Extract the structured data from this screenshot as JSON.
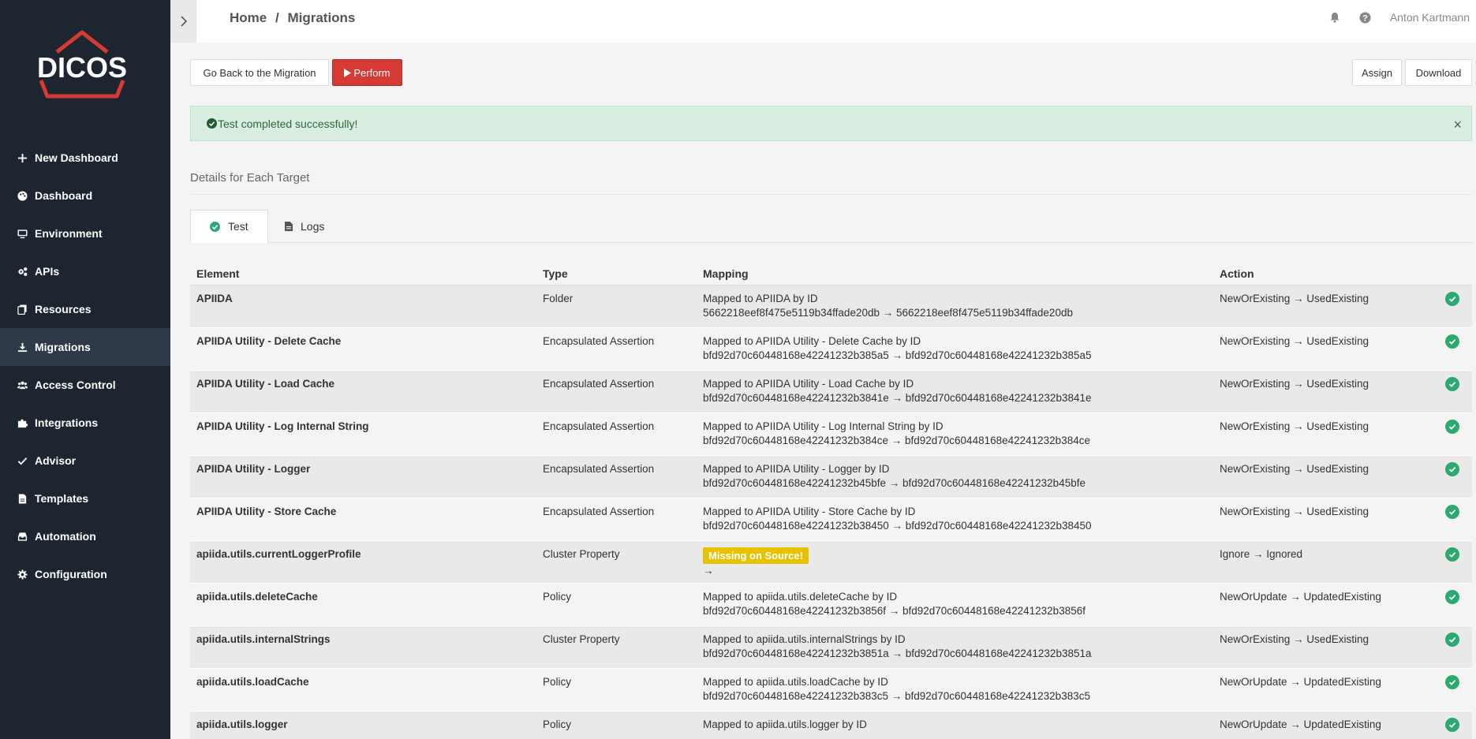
{
  "brand": {
    "name": "DICOS",
    "accent": "#d63a35"
  },
  "sidebar": {
    "items": [
      {
        "label": "New Dashboard",
        "icon": "plus-icon",
        "active": false
      },
      {
        "label": "Dashboard",
        "icon": "palette-icon",
        "active": false
      },
      {
        "label": "Environment",
        "icon": "monitor-icon",
        "active": false
      },
      {
        "label": "APIs",
        "icon": "cogs-icon",
        "active": false
      },
      {
        "label": "Resources",
        "icon": "copy-icon",
        "active": false
      },
      {
        "label": "Migrations",
        "icon": "download-icon",
        "active": true
      },
      {
        "label": "Access Control",
        "icon": "users-icon",
        "active": false
      },
      {
        "label": "Integrations",
        "icon": "puzzle-icon",
        "active": false
      },
      {
        "label": "Advisor",
        "icon": "check-icon",
        "active": false
      },
      {
        "label": "Templates",
        "icon": "file-icon",
        "active": false
      },
      {
        "label": "Automation",
        "icon": "inbox-icon",
        "active": false
      },
      {
        "label": "Configuration",
        "icon": "gear-icon",
        "active": false
      }
    ]
  },
  "header": {
    "breadcrumb": {
      "home": "Home",
      "sep": "/",
      "current": "Migrations"
    },
    "user": "Anton Kartmann"
  },
  "toolbar": {
    "back_label": "Go Back to the Migration",
    "perform_label": "Perform",
    "assign_label": "Assign",
    "download_label": "Download"
  },
  "alert": {
    "message": "Test completed successfully!",
    "close": "×"
  },
  "section": {
    "title": "Details for Each Target"
  },
  "tabs": [
    {
      "label": "Test",
      "icon": "check-circle-icon",
      "active": true
    },
    {
      "label": "Logs",
      "icon": "file-icon",
      "active": false
    }
  ],
  "table": {
    "headers": {
      "element": "Element",
      "type": "Type",
      "mapping": "Mapping",
      "action": "Action"
    },
    "rows": [
      {
        "element": "APIIDA",
        "type": "Folder",
        "mapping1": "Mapped to APIIDA by ID",
        "mapping2": "5662218eef8f475e5119b34ffade20db → 5662218eef8f475e5119b34ffade20db",
        "action": "NewOrExisting → UsedExisting",
        "badge": ""
      },
      {
        "element": "APIIDA Utility - Delete Cache",
        "type": "Encapsulated Assertion",
        "mapping1": "Mapped to APIIDA Utility - Delete Cache by ID",
        "mapping2": "bfd92d70c60448168e42241232b385a5 → bfd92d70c60448168e42241232b385a5",
        "action": "NewOrExisting → UsedExisting",
        "badge": ""
      },
      {
        "element": "APIIDA Utility - Load Cache",
        "type": "Encapsulated Assertion",
        "mapping1": "Mapped to APIIDA Utility - Load Cache by ID",
        "mapping2": "bfd92d70c60448168e42241232b3841e → bfd92d70c60448168e42241232b3841e",
        "action": "NewOrExisting → UsedExisting",
        "badge": ""
      },
      {
        "element": "APIIDA Utility - Log Internal String",
        "type": "Encapsulated Assertion",
        "mapping1": "Mapped to APIIDA Utility - Log Internal String by ID",
        "mapping2": "bfd92d70c60448168e42241232b384ce → bfd92d70c60448168e42241232b384ce",
        "action": "NewOrExisting → UsedExisting",
        "badge": ""
      },
      {
        "element": "APIIDA Utility - Logger",
        "type": "Encapsulated Assertion",
        "mapping1": "Mapped to APIIDA Utility - Logger by ID",
        "mapping2": "bfd92d70c60448168e42241232b45bfe → bfd92d70c60448168e42241232b45bfe",
        "action": "NewOrExisting → UsedExisting",
        "badge": ""
      },
      {
        "element": "APIIDA Utility - Store Cache",
        "type": "Encapsulated Assertion",
        "mapping1": "Mapped to APIIDA Utility - Store Cache by ID",
        "mapping2": "bfd92d70c60448168e42241232b38450 → bfd92d70c60448168e42241232b38450",
        "action": "NewOrExisting → UsedExisting",
        "badge": ""
      },
      {
        "element": "apiida.utils.currentLoggerProfile",
        "type": "Cluster Property",
        "mapping1": "",
        "mapping2": "→",
        "action": "Ignore → Ignored",
        "badge": "Missing on Source!"
      },
      {
        "element": "apiida.utils.deleteCache",
        "type": "Policy",
        "mapping1": "Mapped to apiida.utils.deleteCache by ID",
        "mapping2": "bfd92d70c60448168e42241232b3856f → bfd92d70c60448168e42241232b3856f",
        "action": "NewOrUpdate → UpdatedExisting",
        "badge": ""
      },
      {
        "element": "apiida.utils.internalStrings",
        "type": "Cluster Property",
        "mapping1": "Mapped to apiida.utils.internalStrings by ID",
        "mapping2": "bfd92d70c60448168e42241232b3851a → bfd92d70c60448168e42241232b3851a",
        "action": "NewOrExisting → UsedExisting",
        "badge": ""
      },
      {
        "element": "apiida.utils.loadCache",
        "type": "Policy",
        "mapping1": "Mapped to apiida.utils.loadCache by ID",
        "mapping2": "bfd92d70c60448168e42241232b383c5 → bfd92d70c60448168e42241232b383c5",
        "action": "NewOrUpdate → UpdatedExisting",
        "badge": ""
      },
      {
        "element": "apiida.utils.logger",
        "type": "Policy",
        "mapping1": "Mapped to apiida.utils.logger by ID",
        "mapping2": "",
        "action": "NewOrUpdate → UpdatedExisting",
        "badge": ""
      }
    ]
  }
}
